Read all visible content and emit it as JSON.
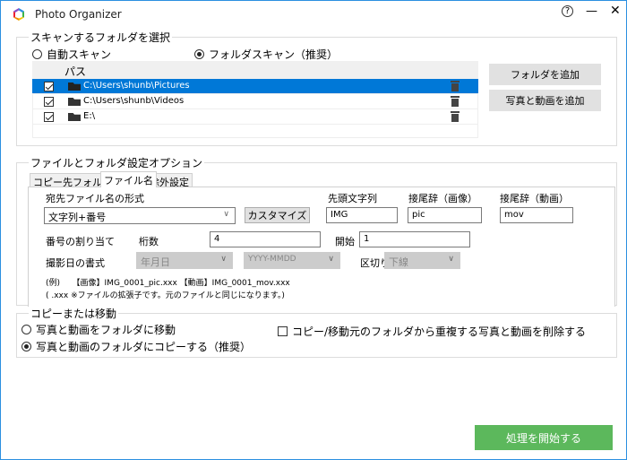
{
  "window": {
    "title": "Photo Organizer",
    "help": "?",
    "minimize": "—",
    "close": "✕"
  },
  "scan": {
    "legend": "スキャンするフォルダを選択",
    "auto_label": "自動スキャン",
    "folder_label": "フォルダスキャン（推奨）",
    "column_path": "パス",
    "rows": [
      {
        "path": "C:\\Users\\shunb\\Pictures",
        "checked": true,
        "selected": true
      },
      {
        "path": "C:\\Users\\shunb\\Videos",
        "checked": true
      },
      {
        "path": "E:\\",
        "checked": true
      }
    ],
    "add_folder": "フォルダを追加",
    "add_media": "写真と動画を追加"
  },
  "options": {
    "legend": "ファイルとフォルダ設定オプション",
    "tabs": [
      "コピー先フォルダ",
      "ファイル名",
      "除外設定"
    ],
    "format_label": "宛先ファイル名の形式",
    "format_value": "文字列+番号",
    "customize": "カスタマイズ",
    "prefix_label": "先頭文字列",
    "prefix_value": "IMG",
    "suffix_img_label": "接尾辞（画像）",
    "suffix_img_value": "pic",
    "suffix_vid_label": "接尾辞（動画）",
    "suffix_vid_value": "mov",
    "number_label": "番号の割り当て",
    "digits_label": "桁数",
    "digits_value": "4",
    "start_label": "開始",
    "start_value": "1",
    "date_label": "撮影日の書式",
    "date_order": "年月日",
    "date_format": "YYYY-MMDD",
    "separator_label": "区切り",
    "separator_value": "下線",
    "example_line1": "(例)　　【画像】IMG_0001_pic.xxx 【動画】IMG_0001_mov.xxx",
    "example_line2": "(  .xxx  ※ファイルの拡張子です。元のファイルと同じになります。)"
  },
  "copy": {
    "legend": "コピーまたは移動",
    "move_label": "写真と動画をフォルダに移動",
    "copy_label": "写真と動画のフォルダにコピーする（推奨）",
    "delete_dup_label": "コピー/移動元のフォルダから重複する写真と動画を削除する"
  },
  "start_button": "処理を開始する"
}
